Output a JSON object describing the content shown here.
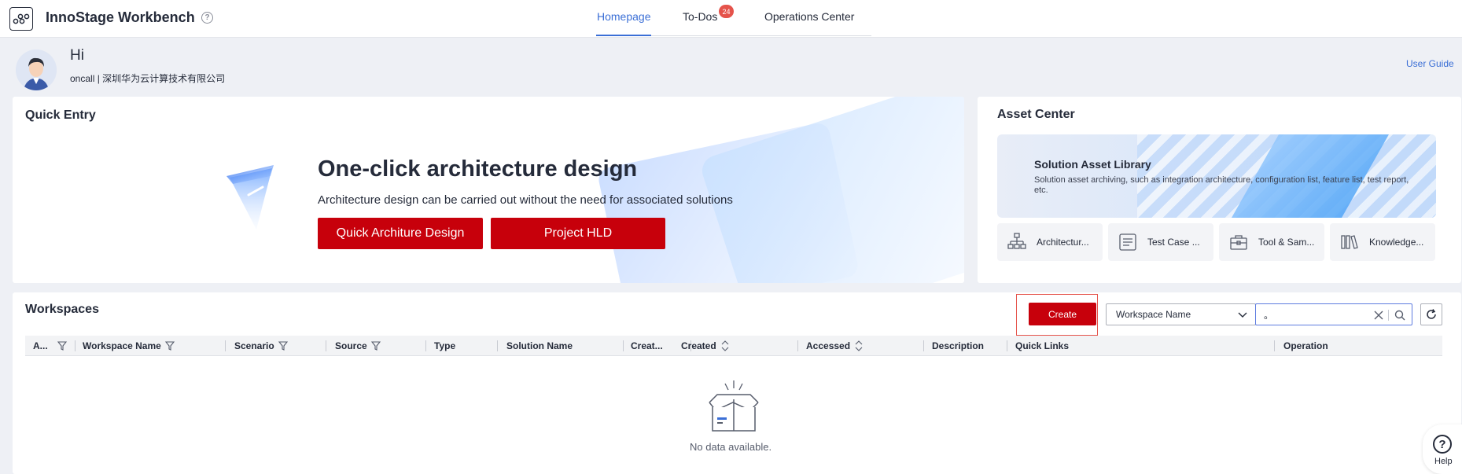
{
  "header": {
    "app_title": "InnoStage Workbench",
    "help_icon": "?",
    "tabs": [
      {
        "label": "Homepage",
        "active": true
      },
      {
        "label": "To-Dos",
        "badge": "24"
      },
      {
        "label": "Operations Center"
      }
    ]
  },
  "user": {
    "greeting": "Hi",
    "subtitle": "oncall | 深圳华为云计算技术有限公司",
    "user_guide": "User Guide"
  },
  "quick_entry": {
    "title": "Quick Entry",
    "headline": "One-click architecture design",
    "description": "Architecture design can be carried out without the need for associated solutions",
    "buttons": [
      "Quick Architure Design",
      "Project HLD"
    ]
  },
  "asset_center": {
    "title": "Asset Center",
    "banner_title": "Solution Asset Library",
    "banner_desc": "Solution asset archiving, such as integration architecture, configuration list, feature list, test report, etc.",
    "cards": [
      {
        "label": "Architectur...",
        "icon": "architecture-icon"
      },
      {
        "label": "Test Case ...",
        "icon": "test-case-icon"
      },
      {
        "label": "Tool & Sam...",
        "icon": "toolbox-icon"
      },
      {
        "label": "Knowledge...",
        "icon": "books-icon"
      }
    ]
  },
  "workspaces": {
    "title": "Workspaces",
    "create_label": "Create",
    "select_value": "Workspace Name",
    "search_value": "。",
    "columns": [
      {
        "label": "A...",
        "filter": true
      },
      {
        "label": "Workspace Name",
        "filter": true
      },
      {
        "label": "Scenario",
        "filter": true
      },
      {
        "label": "Source",
        "filter": true
      },
      {
        "label": "Type"
      },
      {
        "label": "Solution Name"
      },
      {
        "label": "Creat..."
      },
      {
        "label": "Created",
        "sort": true
      },
      {
        "label": "Accessed",
        "sort": true
      },
      {
        "label": "Description"
      },
      {
        "label": "Quick Links"
      },
      {
        "label": "Operation"
      }
    ],
    "empty_text": "No data available."
  },
  "help_float": {
    "label": "Help"
  },
  "colors": {
    "brand_red": "#c7000b",
    "accent_blue": "#3b6fd6",
    "badge_red": "#e5534b"
  }
}
